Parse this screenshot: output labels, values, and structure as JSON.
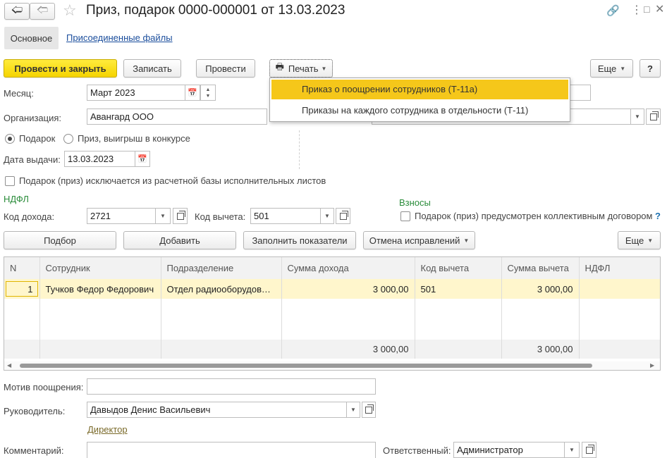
{
  "window": {
    "title": "Приз, подарок 0000-000001 от 13.03.2023"
  },
  "tabs": {
    "main": "Основное",
    "files": "Присоединенные файлы"
  },
  "toolbar": {
    "post_close": "Провести и закрыть",
    "save": "Записать",
    "post": "Провести",
    "print": "Печать",
    "more": "Еще",
    "help": "?"
  },
  "print_menu": {
    "items": [
      "Приказ о поощрении сотрудников (Т-11а)",
      "Приказы на каждого сотрудника в отдельности (Т-11)"
    ]
  },
  "form": {
    "month_label": "Месяц:",
    "month_value": "Март 2023",
    "org_label": "Организация:",
    "org_value": "Авангард ООО",
    "radio_gift": "Подарок",
    "radio_prize": "Приз, выигрыш в конкурсе",
    "date_label": "Дата выдачи:",
    "date_value": "13.03.2023",
    "exclude_label": "Подарок (приз) исключается из расчетной базы исполнительных листов",
    "ndfl_header": "НДФЛ",
    "income_code_label": "Код дохода:",
    "income_code_value": "2721",
    "deduction_code_label": "Код вычета:",
    "deduction_code_value": "501",
    "contrib_header": "Взносы",
    "collective_label": "Подарок (приз) предусмотрен коллективным договором",
    "collective_help": "?"
  },
  "table_toolbar": {
    "select": "Подбор",
    "add": "Добавить",
    "fill": "Заполнить показатели",
    "undo": "Отмена исправлений",
    "more": "Еще"
  },
  "table": {
    "headers": [
      "N",
      "Сотрудник",
      "Подразделение",
      "Сумма дохода",
      "Код вычета",
      "Сумма вычета",
      "НДФЛ"
    ],
    "rows": [
      [
        "1",
        "Тучков Федор Федорович",
        "Отдел радиооборудования",
        "3 000,00",
        "501",
        "3 000,00",
        ""
      ]
    ],
    "totals": [
      "",
      "",
      "",
      "3 000,00",
      "",
      "3 000,00",
      ""
    ]
  },
  "footer": {
    "motive_label": "Мотив поощрения:",
    "motive_value": "",
    "head_label": "Руководитель:",
    "head_value": "Давыдов Денис Васильевич",
    "head_position": "Директор",
    "comment_label": "Комментарий:",
    "comment_value": "",
    "responsible_label": "Ответственный:",
    "responsible_value": "Администратор"
  },
  "colors": {
    "accent_yellow": "#f5d400",
    "row_highlight": "#fff6cc",
    "menu_highlight": "#f5c71a",
    "link": "#1a4d9c",
    "green_header": "#2a8c3a"
  }
}
